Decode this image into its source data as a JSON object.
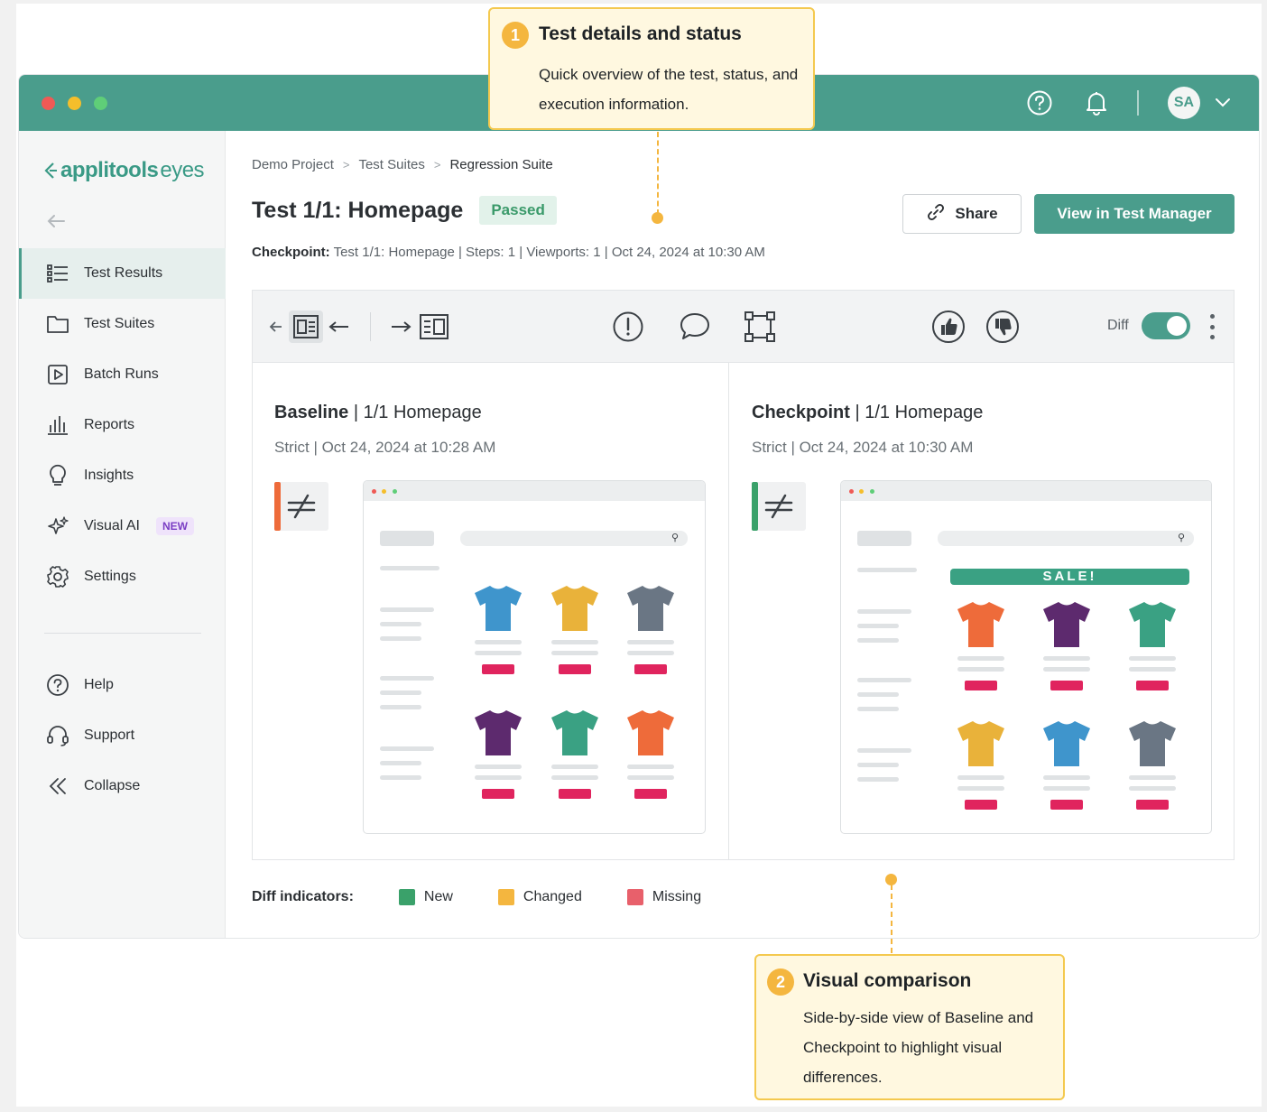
{
  "window": {
    "help_icon": "help-circle-icon",
    "bell_icon": "bell-icon",
    "avatar_initials": "SA",
    "colors": {
      "titlebar": "#4a9d8c",
      "accent": "#4a9d8c"
    }
  },
  "sidebar": {
    "logo_bold": "applitools",
    "logo_light": "eyes",
    "items": [
      {
        "label": "Test Results",
        "icon": "list-icon",
        "active": true
      },
      {
        "label": "Test Suites",
        "icon": "folder-icon"
      },
      {
        "label": "Batch Runs",
        "icon": "play-icon"
      },
      {
        "label": "Reports",
        "icon": "bar-chart-icon"
      },
      {
        "label": "Insights",
        "icon": "lightbulb-icon"
      },
      {
        "label": "Visual AI",
        "icon": "sparkles-icon",
        "badge": "NEW"
      },
      {
        "label": "Settings",
        "icon": "gear-icon"
      }
    ],
    "footer_items": [
      {
        "label": "Help",
        "icon": "help-circle-icon"
      },
      {
        "label": "Support",
        "icon": "headset-icon"
      },
      {
        "label": "Collapse",
        "icon": "double-chevron-left-icon"
      }
    ]
  },
  "breadcrumb": [
    "Demo Project",
    "Test Suites",
    "Regression Suite"
  ],
  "header": {
    "title": "Test 1/1: Homepage",
    "status": "Passed",
    "share_label": "Share",
    "view_label": "View in Test Manager"
  },
  "meta": {
    "checkpoint_label": "Checkpoint:",
    "text": "Test 1/1: Homepage | Steps: 1 | Viewports: 1 | Oct 24, 2024 at 10:30 AM"
  },
  "toolbar": {
    "diff_label": "Diff",
    "diff_on": true
  },
  "baseline": {
    "title": "Baseline",
    "name": "| 1/1 Homepage",
    "sub": "Strict  |  Oct 24, 2024 at 10:28 AM",
    "bar_color": "#ee6b3a",
    "shirts": [
      "#3f95cc",
      "#e9b23a",
      "#6a7684",
      "#5d2a6e",
      "#3aa183",
      "#ee6b3a"
    ]
  },
  "checkpoint": {
    "title": "Checkpoint",
    "name": "| 1/1 Homepage",
    "sub": "Strict  |  Oct 24, 2024 at 10:30 AM",
    "bar_color": "#3aa16a",
    "sale_text": "SALE!",
    "shirts": [
      "#ee6b3a",
      "#5d2a6e",
      "#3aa183",
      "#e9b23a",
      "#3f95cc",
      "#6a7684"
    ]
  },
  "legend": {
    "title": "Diff indicators:",
    "items": [
      {
        "label": "New",
        "color": "#3aa16a"
      },
      {
        "label": "Changed",
        "color": "#f4b63f"
      },
      {
        "label": "Missing",
        "color": "#e8606b"
      }
    ]
  },
  "callouts": [
    {
      "num": "1",
      "title": "Test details and status",
      "text": "Quick overview of the test, status, and execution information."
    },
    {
      "num": "2",
      "title": "Visual comparison",
      "text": "Side-by-side view of Baseline and Checkpoint to highlight visual differences."
    }
  ]
}
